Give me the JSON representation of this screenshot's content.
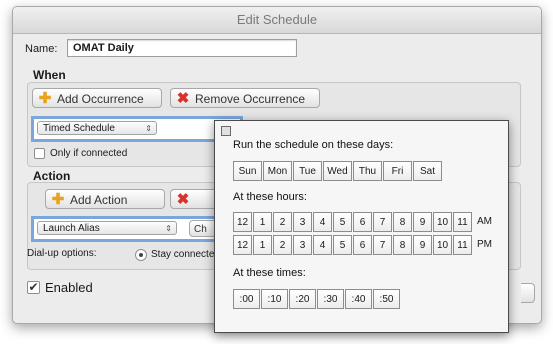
{
  "window": {
    "title": "Edit Schedule"
  },
  "name": {
    "label": "Name:",
    "value": "OMAT Daily"
  },
  "when": {
    "heading": "When",
    "add_button": "Add Occurrence",
    "remove_button": "Remove Occurrence",
    "schedule_popup": "Timed Schedule",
    "only_if_connected": "Only if connected"
  },
  "action": {
    "heading": "Action",
    "add_button": "Add Action",
    "action_popup": "Launch Alias",
    "choose_button_partial": "Ch",
    "dialup_label": "Dial-up options:",
    "stay_connected": "Stay connected"
  },
  "enabled": {
    "label": "Enabled",
    "checked": true
  },
  "popover": {
    "days_heading": "Run the schedule on these days:",
    "days": [
      "Sun",
      "Mon",
      "Tue",
      "Wed",
      "Thu",
      "Fri",
      "Sat"
    ],
    "hours_heading": "At these hours:",
    "hours": [
      "12",
      "1",
      "2",
      "3",
      "4",
      "5",
      "6",
      "7",
      "8",
      "9",
      "10",
      "11"
    ],
    "am_label": "AM",
    "pm_label": "PM",
    "times_heading": "At these times:",
    "times": [
      ":00",
      ":10",
      ":20",
      ":30",
      ":40",
      ":50"
    ]
  }
}
